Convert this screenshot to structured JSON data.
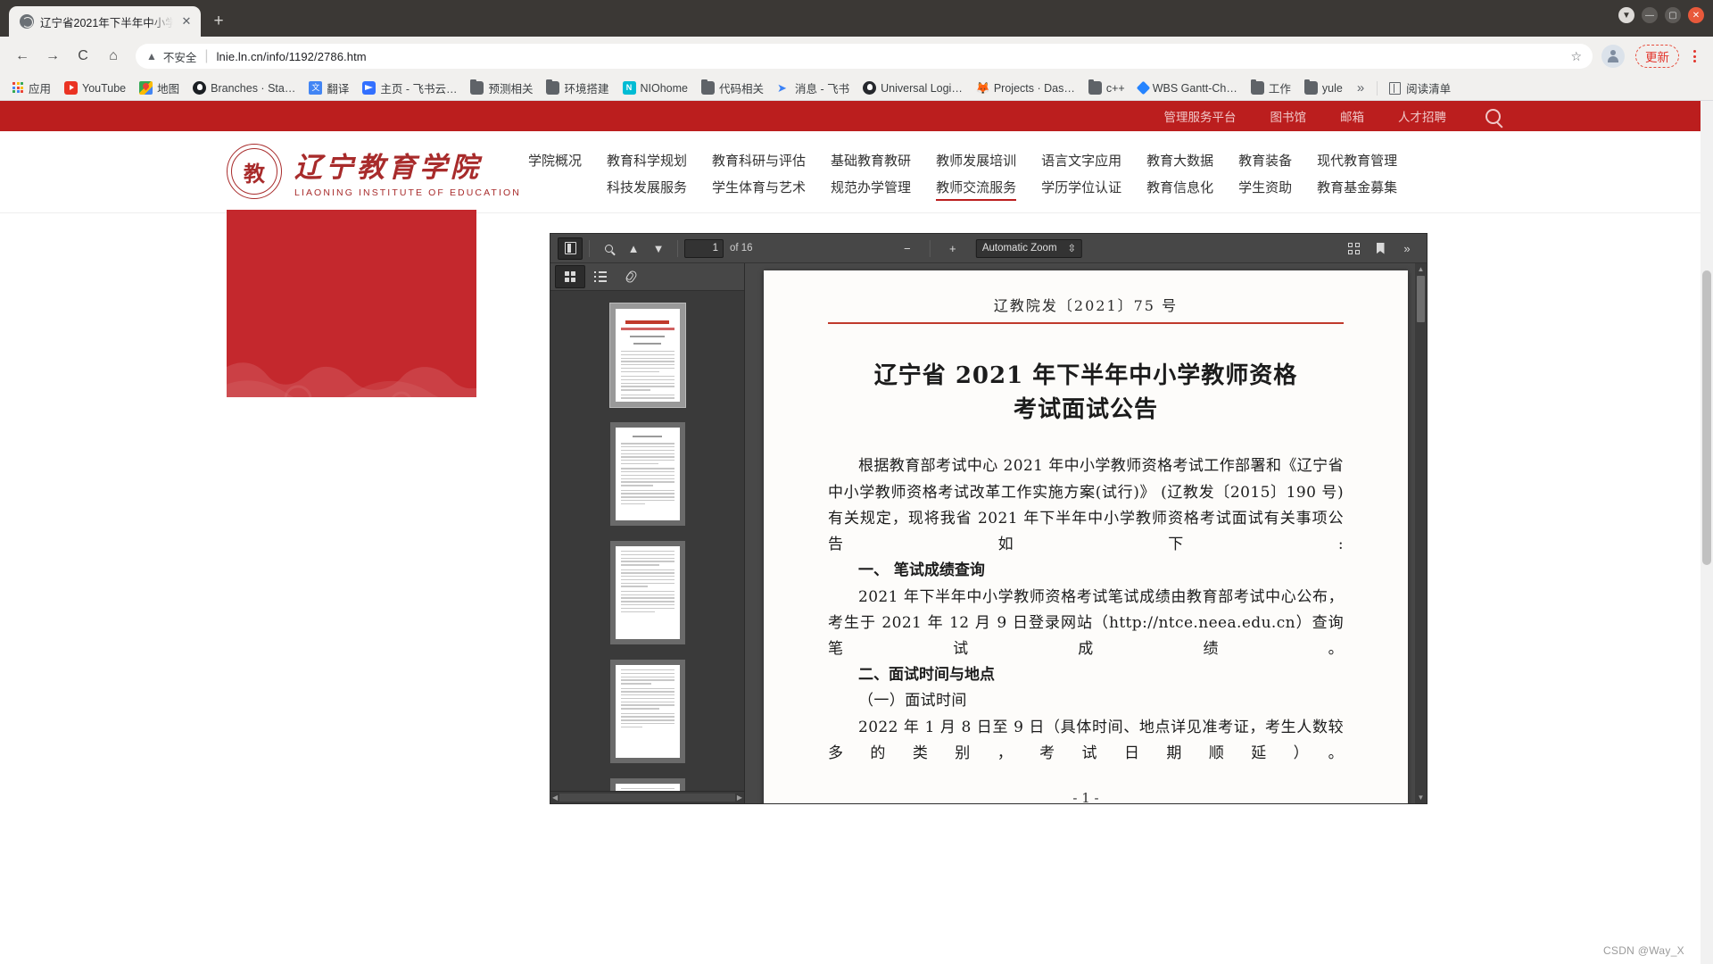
{
  "browser": {
    "tab": {
      "title": "辽宁省2021年下半年中小学…",
      "favicon": "globe-icon",
      "close": "✕"
    },
    "newtab_label": "+",
    "window_controls": {
      "drop": "▼",
      "minimize": "—",
      "maximize": "▢",
      "close": "✕"
    },
    "nav": {
      "back": "←",
      "forward": "→",
      "reload": "C",
      "home": "⌂"
    },
    "omnibox": {
      "warning_icon": "▲",
      "warning_label": "不安全",
      "separator": "|",
      "url": "lnie.ln.cn/info/1192/2786.htm",
      "star": "☆"
    },
    "update_button": "更新",
    "bookmarks": [
      {
        "label": "应用",
        "icon": "apps-grid-icon"
      },
      {
        "label": "YouTube",
        "icon": "youtube-icon"
      },
      {
        "label": "地图",
        "icon": "maps-icon"
      },
      {
        "label": "Branches · Sta…",
        "icon": "github-icon"
      },
      {
        "label": "翻译",
        "icon": "google-translate-icon"
      },
      {
        "label": "主页 - 飞书云…",
        "icon": "feishu-icon"
      },
      {
        "label": "预测相关",
        "icon": "folder-icon"
      },
      {
        "label": "环境搭建",
        "icon": "folder-icon"
      },
      {
        "label": "NIOhome",
        "icon": "nio-icon"
      },
      {
        "label": "代码相关",
        "icon": "folder-icon"
      },
      {
        "label": "消息 - 飞书",
        "icon": "paper-plane-icon"
      },
      {
        "label": "Universal Logi…",
        "icon": "universal-icon"
      },
      {
        "label": "Projects · Das…",
        "icon": "gitlab-fox-icon"
      },
      {
        "label": "c++",
        "icon": "folder-icon"
      },
      {
        "label": "WBS Gantt-Ch…",
        "icon": "jira-diamond-icon"
      },
      {
        "label": "工作",
        "icon": "folder-icon"
      },
      {
        "label": "yule",
        "icon": "folder-icon"
      }
    ],
    "bookmarks_overflow": "»",
    "reading_list": "阅读清单"
  },
  "site": {
    "topbar": {
      "links": [
        "管理服务平台",
        "图书馆",
        "邮箱",
        "人才招聘"
      ],
      "search_icon": "search-icon",
      "bg_color": "#bb1e1e"
    },
    "logo": {
      "seal_char": "教",
      "name_cn": "辽宁教育学院",
      "name_en": "LIAONING INSTITUTE OF EDUCATION",
      "color": "#a82b2b"
    },
    "nav_columns": [
      {
        "top": "学院概况",
        "bottom": "",
        "active": false
      },
      {
        "top": "教育科学规划",
        "bottom": "科技发展服务",
        "active": false
      },
      {
        "top": "教育科研与评估",
        "bottom": "学生体育与艺术",
        "active": false
      },
      {
        "top": "基础教育教研",
        "bottom": "规范办学管理",
        "active": false
      },
      {
        "top": "教师发展培训",
        "bottom": "教师交流服务",
        "active": true
      },
      {
        "top": "语言文字应用",
        "bottom": "学历学位认证",
        "active": false
      },
      {
        "top": "教育大数据",
        "bottom": "教育信息化",
        "active": false
      },
      {
        "top": "教育装备",
        "bottom": "学生资助",
        "active": false
      },
      {
        "top": "现代教育管理",
        "bottom": "教育基金募集",
        "active": false
      }
    ],
    "banner": {
      "color": "#c4282d",
      "pattern": "wave-pattern"
    },
    "watermark": "CSDN @Way_X"
  },
  "pdf_viewer": {
    "toolbar": {
      "sidebar_toggle": "sidebar-toggle-icon",
      "find": "search-icon",
      "prev_page": "up-arrow-icon",
      "next_page": "down-arrow-icon",
      "page_number": "1",
      "page_total": "of 16",
      "zoom_out": "−",
      "zoom_in": "+",
      "zoom_level": "Automatic Zoom",
      "zoom_caret": "⇳",
      "presentation": "fullscreen-icon",
      "bookmark": "bookmark-icon",
      "more_tools": "»"
    },
    "sidebar": {
      "thumbnails_btn": "thumbnails-grid-icon",
      "outline_btn": "document-outline-icon",
      "attachments_btn": "paperclip-icon",
      "thumbnail_count": 5,
      "selected_thumbnail": 1,
      "first_thumb_title": "辽宁教育学院文件"
    },
    "document": {
      "doc_number": "辽教院发〔2021〕75 号",
      "title_line1": "辽宁省 2021 年下半年中小学教师资格",
      "title_line2": "考试面试公告",
      "paragraphs": [
        "根据教育部考试中心 2021 年中小学教师资格考试工作部署和《辽宁省中小学教师资格考试改革工作实施方案(试行)》 (辽教发〔2015〕190 号)有关规定，现将我省 2021 年下半年中小学教师资格考试面试有关事项公告如下:"
      ],
      "heading1": "一、 笔试成绩查询",
      "paragraph2": "2021 年下半年中小学教师资格考试笔试成绩由教育部考试中心公布，考生于 2021 年 12 月 9 日登录网站（http://ntce.neea.edu.cn）查询笔试成绩。",
      "heading2": "二、面试时间与地点",
      "heading3": "（一）面试时间",
      "paragraph3": "2022 年 1 月 8 日至 9 日（具体时间、地点详见准考证，考生人数较多的类别，考试日期顺延）。",
      "footer_page": "- 1 -"
    }
  }
}
